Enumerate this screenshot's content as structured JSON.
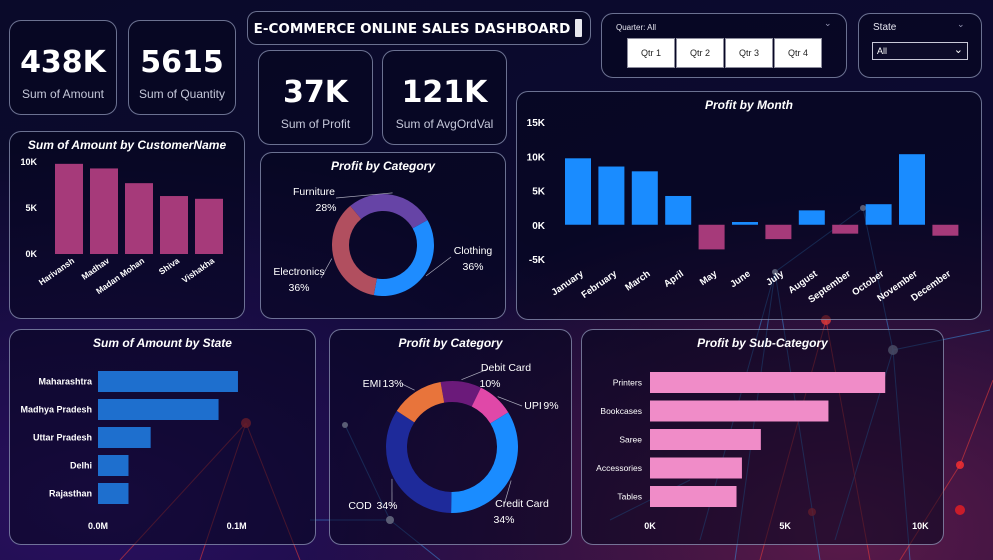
{
  "dashboard": {
    "title": "E-COMMERCE ONLINE SALES DASHBOARD"
  },
  "kpis": [
    {
      "value": "438K",
      "label": "Sum of Amount"
    },
    {
      "value": "5615",
      "label": "Sum of Quantity"
    },
    {
      "value": "37K",
      "label": "Sum of Profit"
    },
    {
      "value": "121K",
      "label": "Sum of AvgOrdVal"
    }
  ],
  "quarter_slicer": {
    "header": "Quarter: All",
    "options": [
      "Qtr 1",
      "Qtr 2",
      "Qtr 3",
      "Qtr 4"
    ]
  },
  "state_slicer": {
    "header": "State",
    "selected": "All"
  },
  "colors": {
    "customer_bar": "#a63a7a",
    "month_bar": "#1a8cff",
    "state_bar": "#1e6fce",
    "subcat_bar": "#f08cc8",
    "cat_furniture": "#6644a6",
    "cat_clothing": "#1e8cff",
    "cat_electronics": "#b14f5f",
    "pay_cod": "#1e2a9a",
    "pay_credit": "#1a8cff",
    "pay_emi": "#e8743b",
    "pay_debit": "#6b1a7a",
    "pay_upi": "#e048a8"
  },
  "chart_data": [
    {
      "id": "customer",
      "type": "bar",
      "title": "Sum of Amount by CustomerName",
      "categories": [
        "Harivansh",
        "Madhav",
        "Madan Mohan",
        "Shiva",
        "Vishakha"
      ],
      "values": [
        9800,
        9300,
        7700,
        6300,
        6000
      ],
      "ylim": [
        0,
        10000
      ],
      "yticks": [
        0,
        5000,
        10000
      ],
      "ytick_labels": [
        "0K",
        "5K",
        "10K"
      ]
    },
    {
      "id": "category",
      "type": "pie",
      "title": "Profit by Category",
      "labels": [
        "Furniture",
        "Clothing",
        "Electronics"
      ],
      "values": [
        28,
        36,
        36
      ],
      "value_labels": [
        "28%",
        "36%",
        "36%"
      ]
    },
    {
      "id": "month",
      "type": "bar",
      "title": "Profit by Month",
      "categories": [
        "January",
        "February",
        "March",
        "April",
        "May",
        "June",
        "July",
        "August",
        "September",
        "October",
        "November",
        "December"
      ],
      "values": [
        9700,
        8500,
        7800,
        4200,
        -3600,
        400,
        -2100,
        2100,
        -1300,
        3000,
        10300,
        -1600
      ],
      "ylim": [
        -5000,
        15000
      ],
      "yticks": [
        -5000,
        0,
        5000,
        10000,
        15000
      ],
      "ytick_labels": [
        "-5K",
        "0K",
        "5K",
        "10K",
        "15K"
      ]
    },
    {
      "id": "state",
      "type": "bar",
      "title": "Sum of Amount by State",
      "categories": [
        "Maharashtra",
        "Madhya Pradesh",
        "Uttar Pradesh",
        "Delhi",
        "Rajasthan"
      ],
      "values": [
        0.101,
        0.087,
        0.038,
        0.022,
        0.022
      ],
      "xlim": [
        0,
        0.14
      ],
      "xticks": [
        0,
        0.1
      ],
      "xtick_labels": [
        "0.0M",
        "0.1M"
      ]
    },
    {
      "id": "payment",
      "type": "pie",
      "title": "Profit by Category",
      "labels": [
        "COD",
        "Credit Card",
        "EMI",
        "Debit Card",
        "UPI"
      ],
      "values": [
        34,
        34,
        13,
        10,
        9
      ],
      "value_labels": [
        "34%",
        "34%",
        "13%",
        "10%",
        "9%"
      ]
    },
    {
      "id": "subcat",
      "type": "bar",
      "title": "Profit by Sub-Category",
      "categories": [
        "Printers",
        "Bookcases",
        "Saree",
        "Accessories",
        "Tables"
      ],
      "values": [
        8700,
        6600,
        4100,
        3400,
        3200
      ],
      "xlim": [
        0,
        10800
      ],
      "xticks": [
        0,
        5000,
        10000
      ],
      "xtick_labels": [
        "0K",
        "5K",
        "10K"
      ]
    }
  ]
}
